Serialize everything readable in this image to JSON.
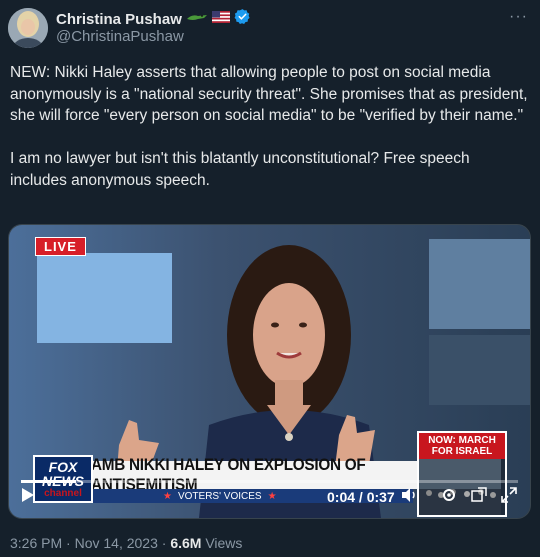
{
  "author": {
    "name": "Christina Pushaw",
    "handle": "@ChristinaPushaw",
    "badges": [
      "alligator-emoji",
      "us-flag-emoji",
      "verified-badge"
    ]
  },
  "tweet": {
    "text": "NEW: Nikki Haley asserts that allowing people to post on social media anonymously is a \"national security threat\". She promises that as president, she will force \"every person on social media\" to be \"verified by their name.\"\n\nI am no lawyer but isn't this blatantly unconstitutional? Free speech includes anonymous speech."
  },
  "video": {
    "live_label": "LIVE",
    "network_logo_1": "FOX",
    "network_logo_2": "NEWS",
    "network_logo_3": "channel",
    "chyron": "AMB NIKKI HALEY ON EXPLOSION OF ANTISEMITISM",
    "subbar": "VOTERS' VOICES",
    "promo_line1": "NOW: MARCH",
    "promo_line2": "FOR ISRAEL",
    "time": "0:04 / 0:37",
    "progress_fraction": 0.11
  },
  "meta": {
    "timestamp": "3:26 PM · Nov 14, 2023 · ",
    "views_count": "6.6M",
    "views_label": " Views"
  },
  "colors": {
    "background": "#15202b",
    "text": "#e7e9ea",
    "muted": "#8b98a5",
    "verified": "#1d9bf0",
    "live_red": "#d71e28"
  }
}
